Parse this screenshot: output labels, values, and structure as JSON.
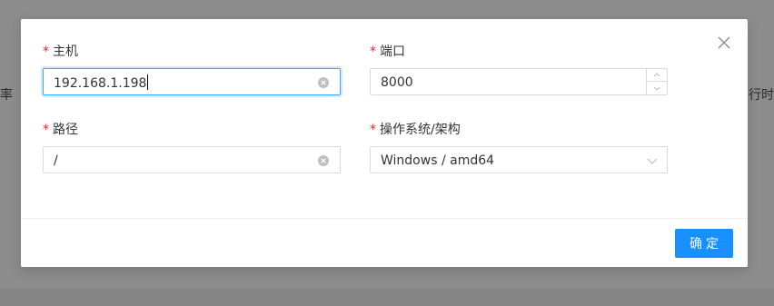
{
  "background": {
    "left_fragment": "率",
    "right_fragment": "行时"
  },
  "modal": {
    "fields": {
      "host": {
        "label": "主机",
        "value": "192.168.1.198"
      },
      "port": {
        "label": "端口",
        "value": "8000"
      },
      "path": {
        "label": "路径",
        "value": "/"
      },
      "os_arch": {
        "label": "操作系统/架构",
        "value": "Windows / amd64"
      }
    },
    "required_mark": "*",
    "confirm_label": "确定"
  },
  "colors": {
    "primary": "#1890ff",
    "required": "#f5222d",
    "overlay": "#8c8c8c"
  },
  "icons": [
    "close-icon",
    "clear-icon",
    "chevron-up-icon",
    "chevron-down-icon"
  ]
}
